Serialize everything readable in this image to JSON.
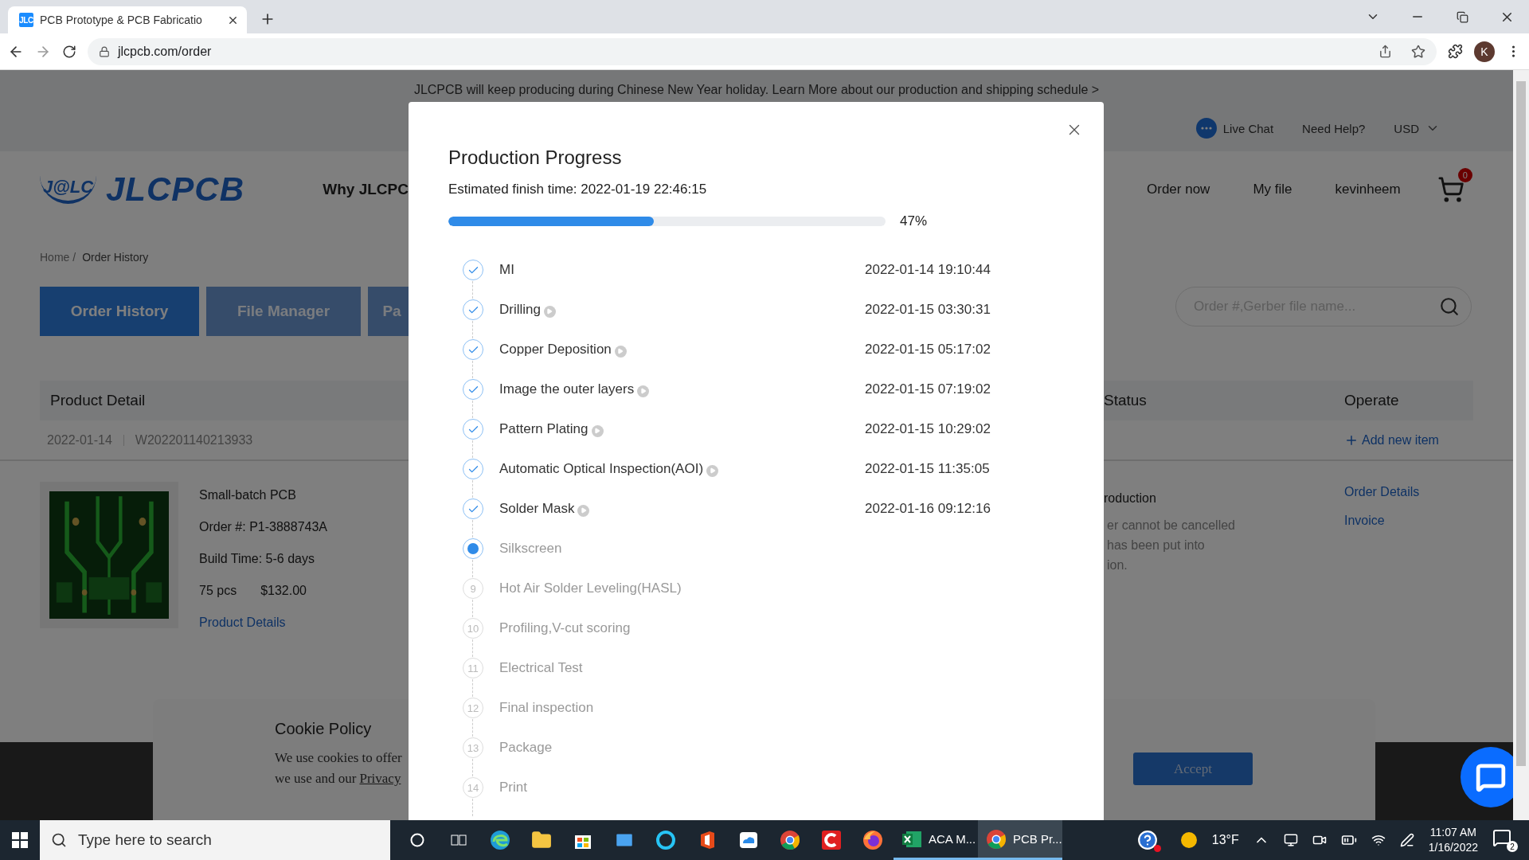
{
  "browser": {
    "favicon": "JLC",
    "tab_title": "PCB Prototype & PCB Fabricatio",
    "url": "jlcpcb.com/order",
    "profile": "K"
  },
  "page": {
    "banner": "JLCPCB will keep producing during Chinese New Year holiday. Learn More about our production and shipping schedule >",
    "utility": {
      "live_chat": "Live Chat",
      "help": "Need Help?",
      "currency": "USD"
    },
    "logo": {
      "badge": "J@LC",
      "name": "JLCPCB"
    },
    "nav_left": "Why JLCPC",
    "nav_right": [
      "Order now",
      "My file",
      "kevinheem"
    ],
    "cart_count": "0",
    "breadcrumb": [
      "Home /",
      "Order History"
    ],
    "tabs": [
      {
        "label": "Order History",
        "selected": true
      },
      {
        "label": "File Manager",
        "selected": false
      },
      {
        "label": "Pa",
        "selected": false
      }
    ],
    "search": {
      "placeholder": "Order #,Gerber file name..."
    },
    "table": {
      "columns": [
        "Product Detail",
        "Status",
        "Operate"
      ],
      "order": {
        "date": "2022-01-14",
        "number": "W202201140213933",
        "add_item": "Add new item",
        "product": {
          "name": "Small-batch PCB",
          "order_no": "Order #: P1-3888743A",
          "build_time": "Build Time: 5-6 days",
          "qty": "75 pcs",
          "price": "$132.00",
          "link": "Product Details"
        },
        "status": [
          "roduction",
          "er cannot be cancelled",
          "has been put into",
          "ion."
        ],
        "actions": [
          "Order Details",
          "Invoice"
        ]
      }
    }
  },
  "cookie": {
    "title": "Cookie Policy",
    "lines": [
      "We use cookies to offer",
      "we use and our"
    ],
    "link": "Privacy",
    "button": "Accept"
  },
  "modal": {
    "title": "Production Progress",
    "estimate": "Estimated finish time: 2022-01-19 22:46:15",
    "progress": {
      "level": 0.47,
      "reading": "47%"
    },
    "steps": [
      {
        "kind": "done",
        "label": "MI",
        "video": false,
        "time": "2022-01-14 19:10:44"
      },
      {
        "kind": "done",
        "label": "Drilling",
        "video": true,
        "time": "2022-01-15 03:30:31"
      },
      {
        "kind": "done",
        "label": "Copper Deposition",
        "video": true,
        "time": "2022-01-15 05:17:02"
      },
      {
        "kind": "done",
        "label": "Image the outer layers",
        "video": true,
        "time": "2022-01-15 07:19:02"
      },
      {
        "kind": "done",
        "label": "Pattern Plating",
        "video": true,
        "time": "2022-01-15 10:29:02"
      },
      {
        "kind": "done",
        "label": "Automatic Optical Inspection(AOI)",
        "video": true,
        "time": "2022-01-15 11:35:05"
      },
      {
        "kind": "done",
        "label": "Solder Mask",
        "video": true,
        "time": "2022-01-16 09:12:16"
      },
      {
        "kind": "current",
        "label": "Silkscreen",
        "video": false
      },
      {
        "kind": "pending",
        "number": "9",
        "label": "Hot Air Solder Leveling(HASL)",
        "video": false
      },
      {
        "kind": "pending",
        "number": "10",
        "label": "Profiling,V-cut scoring",
        "video": false
      },
      {
        "kind": "pending",
        "number": "11",
        "label": "Electrical Test",
        "video": false
      },
      {
        "kind": "pending",
        "number": "12",
        "label": "Final inspection",
        "video": false
      },
      {
        "kind": "pending",
        "number": "13",
        "label": "Package",
        "video": false
      },
      {
        "kind": "pending",
        "number": "14",
        "label": "Print",
        "video": false
      }
    ]
  },
  "taskbar": {
    "search_placeholder": "Type here to search",
    "pinned": [
      {
        "kind": "cortana"
      },
      {
        "kind": "taskview"
      },
      {
        "kind": "edge"
      },
      {
        "kind": "explorer"
      },
      {
        "kind": "store"
      },
      {
        "kind": "mail"
      },
      {
        "kind": "ring"
      },
      {
        "kind": "office"
      },
      {
        "kind": "cloud"
      },
      {
        "kind": "chrome"
      },
      {
        "kind": "ccleaner"
      },
      {
        "kind": "firefox"
      }
    ],
    "windows": [
      {
        "kind": "excel",
        "label": "ACA M...",
        "selected": false
      },
      {
        "kind": "chrome",
        "label": "PCB Pr...",
        "selected": true
      }
    ],
    "weather": "13°F",
    "time": "11:07 AM",
    "date": "1/16/2022",
    "notifications": "2"
  }
}
